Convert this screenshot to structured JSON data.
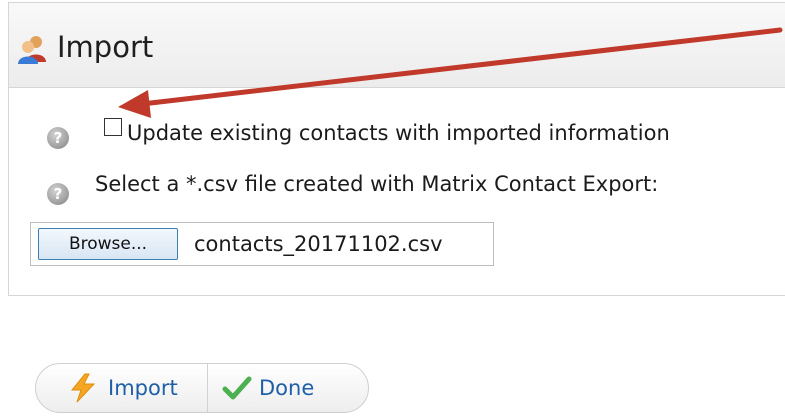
{
  "panel": {
    "title": "Import",
    "icon": "contacts-icon"
  },
  "options": {
    "update_existing_label": "Update existing contacts with imported information",
    "update_existing_checked": false,
    "select_file_label": "Select a *.csv file created with Matrix Contact Export:",
    "help_icon_glyph": "?"
  },
  "file_input": {
    "browse_label": "Browse...",
    "file_name": "contacts_20171102.csv"
  },
  "actions": {
    "import_label": "Import",
    "done_label": "Done"
  },
  "colors": {
    "annotation_arrow": "#c0392b",
    "link_blue": "#1f5fa8"
  }
}
